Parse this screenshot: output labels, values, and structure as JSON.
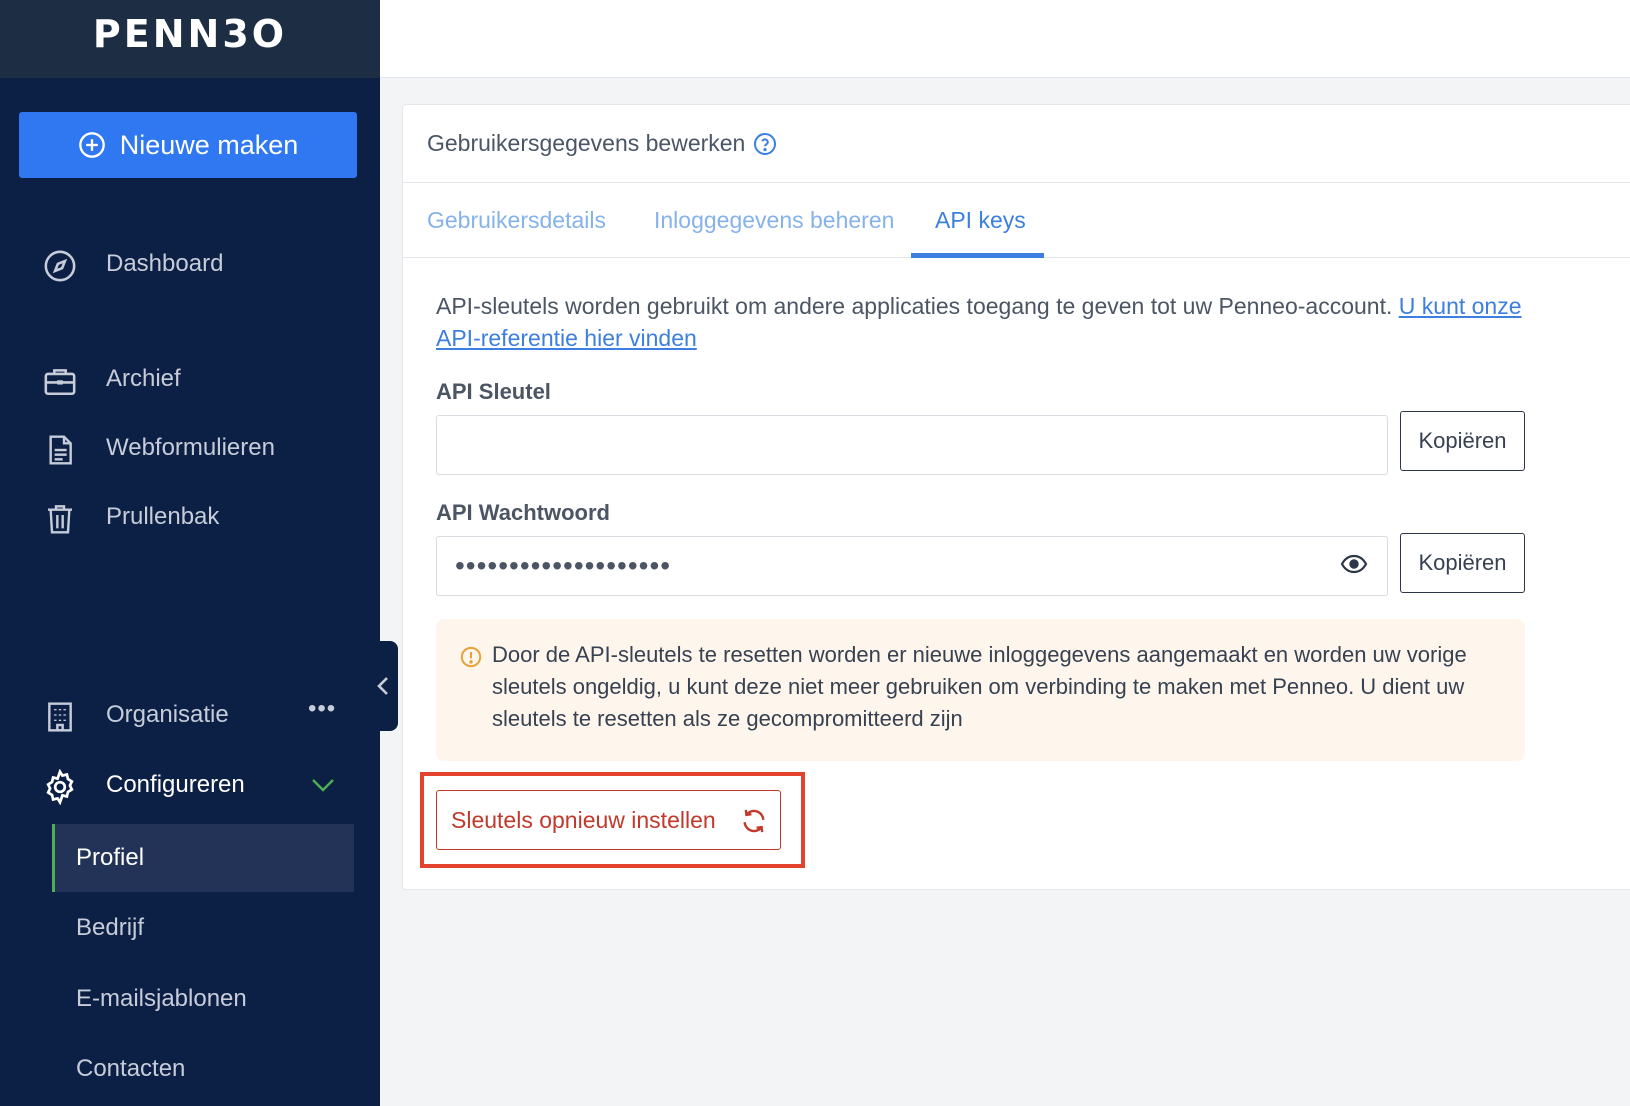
{
  "sidebar": {
    "logo": "PENN3O",
    "new_button": "Nieuwe maken",
    "nav": [
      {
        "label": "Dashboard",
        "icon": "compass-icon"
      },
      {
        "label": "Archief",
        "icon": "briefcase-icon"
      },
      {
        "label": "Webformulieren",
        "icon": "document-icon"
      },
      {
        "label": "Prullenbak",
        "icon": "trash-icon"
      },
      {
        "label": "Organisatie",
        "icon": "building-icon",
        "more": "•••"
      },
      {
        "label": "Configureren",
        "icon": "gear-icon"
      }
    ],
    "sub_items": [
      "Profiel",
      "Bedrijf",
      "E-mailsjablonen",
      "Contacten"
    ],
    "accent_color": "#2f78f1",
    "selected_marker_color": "#4caf50"
  },
  "card": {
    "title": "Gebruikersgegevens bewerken",
    "tabs": [
      "Gebruikersdetails",
      "Inloggegevens beheren",
      "API keys"
    ],
    "active_tab": "API keys",
    "description": "API-sleutels worden gebruikt om andere applicaties toegang te geven tot uw Penneo-account.",
    "description_link": "U kunt onze API-referentie hier vinden",
    "api_key": {
      "label": "API Sleutel",
      "value": "",
      "copy_label": "Kopiëren"
    },
    "api_password": {
      "label": "API Wachtwoord",
      "value": "••••••••••••••••••••",
      "copy_label": "Kopiëren"
    },
    "warning": "Door de API-sleutels te resetten worden er nieuwe inloggegevens aangemaakt en worden uw vorige sleutels ongeldig, u kunt deze niet meer gebruiken om verbinding te maken met Penneo. U dient uw sleutels te resetten als ze gecompromitteerd zijn",
    "reset_button": "Sleutels opnieuw instellen"
  }
}
